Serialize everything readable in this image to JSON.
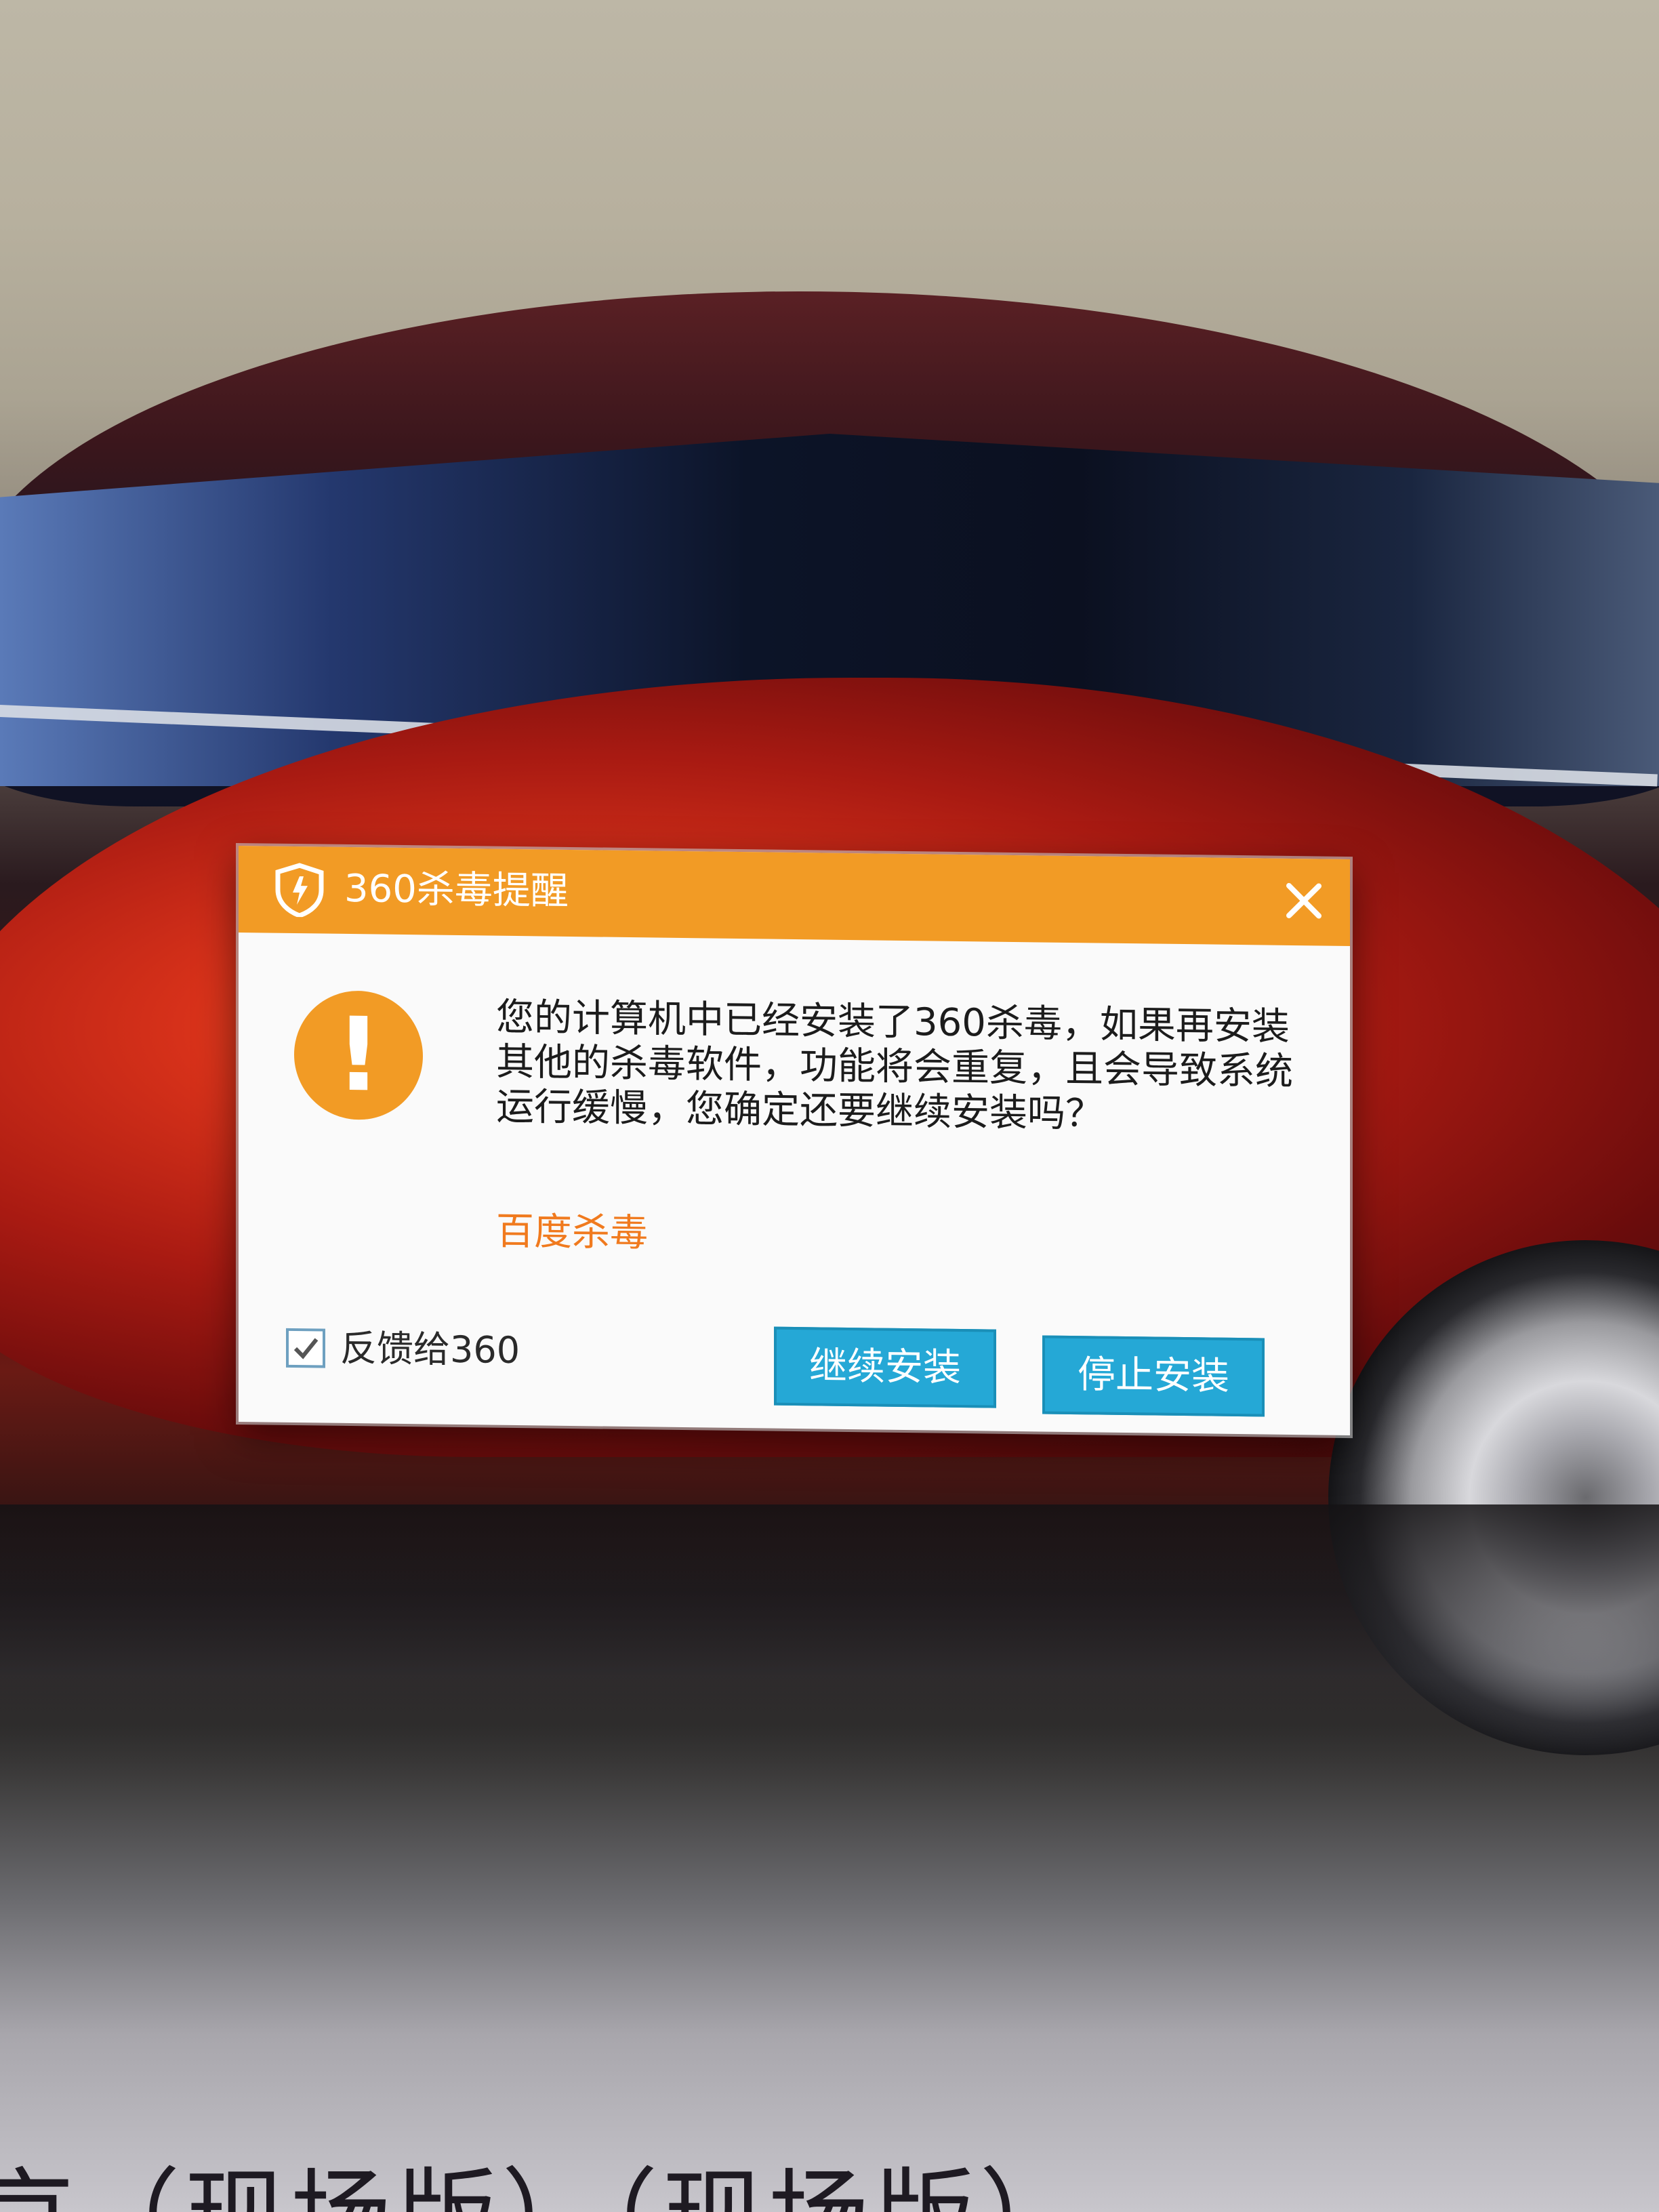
{
  "dialog": {
    "title": "360杀毒提醒",
    "message": "您的计算机中已经安装了360杀毒，如果再安装其他的杀毒软件，功能将会重复，且会导致系统运行缓慢，您确定还要继续安装吗？",
    "link_text": "百度杀毒",
    "feedback_label": "反馈给360",
    "feedback_checked": true,
    "continue_button": "继续安装",
    "stop_button": "停止安装",
    "warning_symbol": "!",
    "icons": {
      "title": "shield-icon",
      "close": "close-icon",
      "warning": "warning-icon",
      "checkbox": "check-icon"
    },
    "colors": {
      "titlebar": "#f29b25",
      "warning": "#f29b25",
      "link": "#f07a1e",
      "button": "#25a8d6"
    }
  },
  "background": {
    "partial_text": "京（现场版）（现场版）"
  }
}
